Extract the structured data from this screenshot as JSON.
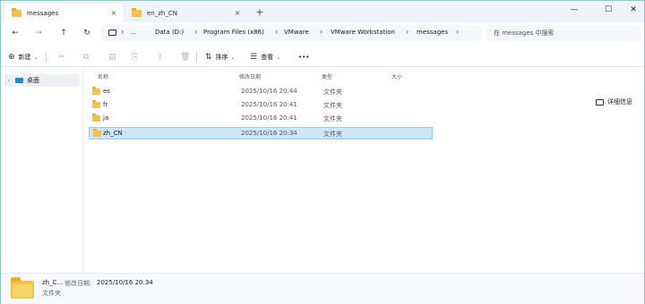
{
  "tabs": [
    {
      "label": "messages",
      "close": "×"
    },
    {
      "label": "en_zh_CN",
      "close": "×"
    }
  ],
  "new_tab": "+",
  "window_controls": {
    "minimize": "—",
    "maximize": "☐",
    "close": "✕"
  },
  "nav": {
    "back": "←",
    "forward": "→",
    "up": "↑",
    "refresh": "↻"
  },
  "breadcrumbs": [
    {
      "label": "…"
    },
    {
      "label": "Data (D:)"
    },
    {
      "label": "Program Files (x86)"
    },
    {
      "label": "VMware"
    },
    {
      "label": "VMware Workstation"
    },
    {
      "label": "messages"
    }
  ],
  "breadcrumb_separator": "›",
  "search": {
    "placeholder": "在 messages 中搜索"
  },
  "commands": {
    "new": "新建",
    "sort": "排序",
    "view": "查看",
    "more": "•••",
    "details": "详细信息"
  },
  "sidebar": {
    "items": [
      {
        "label": "桌面",
        "expander": "›"
      }
    ]
  },
  "columns": {
    "name": "名称",
    "modified": "修改日期",
    "type": "类型",
    "size": "大小"
  },
  "files": [
    {
      "name": "es",
      "modified": "2025/10/16 20:44",
      "type": "文件夹",
      "size": ""
    },
    {
      "name": "fr",
      "modified": "2025/10/16 20:41",
      "type": "文件夹",
      "size": ""
    },
    {
      "name": "ja",
      "modified": "2025/10/16 20:41",
      "type": "文件夹",
      "size": ""
    },
    {
      "name": "zh_CN",
      "modified": "2025/10/16 20:34",
      "type": "文件夹",
      "size": ""
    }
  ],
  "selected_index": 3,
  "status": {
    "name": "zh_C...",
    "modified_label": "修改日期:",
    "modified_value": "2025/10/16 20:34",
    "type": "文件夹"
  },
  "colors": {
    "accent": "#1c8bd6",
    "selection": "#cde6f7",
    "folder": "#f2c14e"
  }
}
